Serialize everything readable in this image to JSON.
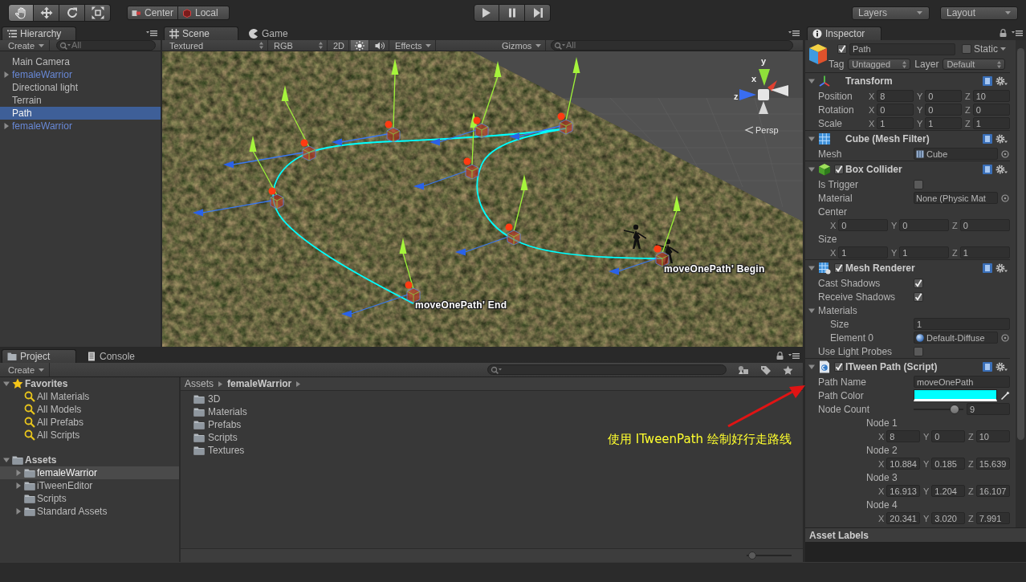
{
  "toolbar": {
    "tools": [
      {
        "kind": "hand",
        "selected": true
      },
      {
        "kind": "move",
        "selected": false
      },
      {
        "kind": "rotate",
        "selected": false
      },
      {
        "kind": "scale",
        "selected": false
      }
    ],
    "pivot": [
      {
        "kind": "pivot",
        "label": "Center"
      },
      {
        "kind": "space",
        "label": "Local"
      }
    ],
    "playback": [
      {
        "kind": "play"
      },
      {
        "kind": "pause"
      },
      {
        "kind": "step"
      }
    ],
    "layers": "Layers",
    "layout": "Layout"
  },
  "hierarchy": {
    "tab": "Hierarchy",
    "create": "Create",
    "search_placeholder": "All",
    "items": [
      {
        "label": "Main Camera",
        "prefab": false,
        "has_children": false,
        "selected": false
      },
      {
        "label": "femaleWarrior",
        "prefab": true,
        "has_children": true,
        "selected": false
      },
      {
        "label": "Directional light",
        "prefab": false,
        "has_children": false,
        "selected": false
      },
      {
        "label": "Terrain",
        "prefab": false,
        "has_children": false,
        "selected": false
      },
      {
        "label": "Path",
        "prefab": false,
        "has_children": false,
        "selected": true
      },
      {
        "label": "femaleWarrior",
        "prefab": true,
        "has_children": true,
        "selected": false
      }
    ]
  },
  "scene": {
    "tabs": [
      {
        "kind": "scene",
        "label": "Scene",
        "selected": true
      },
      {
        "kind": "game",
        "label": "Game",
        "selected": false
      }
    ],
    "toolbar": {
      "draw_mode": "Textured",
      "channel": "RGB",
      "buttons": [
        {
          "kind": "text",
          "label": "2D",
          "on": false
        },
        {
          "kind": "lighting",
          "on": true
        },
        {
          "kind": "audio",
          "on": false
        },
        {
          "kind": "menu",
          "label": "Effects",
          "on": false
        }
      ],
      "gizmos": "Gizmos",
      "search_placeholder": "All"
    },
    "view": {
      "axes": [
        {
          "label": "y"
        },
        {
          "label": "x"
        },
        {
          "label": "z"
        }
      ],
      "projection": "Persp",
      "path_labels": [
        {
          "kind": "begin",
          "text": "moveOnePath' Begin"
        },
        {
          "kind": "end",
          "text": "moveOnePath' End"
        }
      ]
    }
  },
  "inspector": {
    "tab": "Inspector",
    "object": {
      "active": true,
      "name": "Path",
      "static": false,
      "static_label": "Static",
      "tag_label": "Tag",
      "tag": "Untagged",
      "layer_label": "Layer",
      "layer": "Default"
    },
    "components": [
      {
        "kind": "transform",
        "title": "Transform",
        "rows": [
          {
            "kind": "vector3",
            "label": "Position",
            "fields": [
              {
                "axis": "X",
                "value": "8"
              },
              {
                "axis": "Y",
                "value": "0"
              },
              {
                "axis": "Z",
                "value": "10"
              }
            ]
          },
          {
            "kind": "vector3",
            "label": "Rotation",
            "fields": [
              {
                "axis": "X",
                "value": "0"
              },
              {
                "axis": "Y",
                "value": "0"
              },
              {
                "axis": "Z",
                "value": "0"
              }
            ]
          },
          {
            "kind": "vector3",
            "label": "Scale",
            "fields": [
              {
                "axis": "X",
                "value": "1"
              },
              {
                "axis": "Y",
                "value": "1"
              },
              {
                "axis": "Z",
                "value": "1"
              }
            ]
          }
        ]
      },
      {
        "kind": "mesh_filter",
        "title": "Cube (Mesh Filter)",
        "rows": [
          {
            "kind": "object",
            "label": "Mesh",
            "object": {
              "kind": "mesh",
              "label": "Cube"
            }
          }
        ]
      },
      {
        "kind": "box_collider",
        "title": "Box Collider",
        "toggle": {
          "checked": true
        },
        "rows": [
          {
            "kind": "checkbox",
            "label": "Is Trigger",
            "checked": false
          },
          {
            "kind": "object",
            "label": "Material",
            "object": {
              "kind": "none",
              "label": "None (Physic Mat"
            }
          },
          {
            "kind": "vector3_block",
            "label": "Center",
            "fields": [
              {
                "axis": "X",
                "value": "0"
              },
              {
                "axis": "Y",
                "value": "0"
              },
              {
                "axis": "Z",
                "value": "0"
              }
            ]
          },
          {
            "kind": "vector3_block",
            "label": "Size",
            "fields": [
              {
                "axis": "X",
                "value": "1"
              },
              {
                "axis": "Y",
                "value": "1"
              },
              {
                "axis": "Z",
                "value": "1"
              }
            ]
          }
        ]
      },
      {
        "kind": "mesh_renderer",
        "title": "Mesh Renderer",
        "toggle": {
          "checked": true
        },
        "rows": [
          {
            "kind": "checkbox",
            "label": "Cast Shadows",
            "checked": true
          },
          {
            "kind": "checkbox",
            "label": "Receive Shadows",
            "checked": true
          },
          {
            "kind": "foldout",
            "label": "Materials",
            "expanded": true,
            "children": [
              {
                "kind": "text",
                "label": "Size",
                "value": "1"
              },
              {
                "kind": "object",
                "label": "Element 0",
                "object": {
                  "kind": "material",
                  "label": "Default-Diffuse"
                }
              }
            ]
          },
          {
            "kind": "checkbox",
            "label": "Use Light Probes",
            "checked": false
          }
        ]
      },
      {
        "kind": "script",
        "title": "ITween Path (Script)",
        "toggle": {
          "checked": true
        },
        "rows": [
          {
            "kind": "text",
            "label": "Path Name",
            "value": "moveOnePath"
          },
          {
            "kind": "color",
            "label": "Path Color",
            "color": "#00ffff"
          },
          {
            "kind": "slider",
            "label": "Node Count",
            "level": 0.9,
            "value": "9"
          },
          {
            "kind": "nodes",
            "children": [
              {
                "kind": "vector3_block",
                "label": "Node 1",
                "fields": [
                  {
                    "axis": "X",
                    "value": "8"
                  },
                  {
                    "axis": "Y",
                    "value": "0"
                  },
                  {
                    "axis": "Z",
                    "value": "10"
                  }
                ]
              },
              {
                "kind": "vector3_block",
                "label": "Node 2",
                "fields": [
                  {
                    "axis": "X",
                    "value": "10.884"
                  },
                  {
                    "axis": "Y",
                    "value": "0.185"
                  },
                  {
                    "axis": "Z",
                    "value": "15.639"
                  }
                ]
              },
              {
                "kind": "vector3_block",
                "label": "Node 3",
                "fields": [
                  {
                    "axis": "X",
                    "value": "16.913"
                  },
                  {
                    "axis": "Y",
                    "value": "1.204"
                  },
                  {
                    "axis": "Z",
                    "value": "16.107"
                  }
                ]
              },
              {
                "kind": "vector3_block",
                "label": "Node 4",
                "fields": [
                  {
                    "axis": "X",
                    "value": "20.341"
                  },
                  {
                    "axis": "Y",
                    "value": "3.020"
                  },
                  {
                    "axis": "Z",
                    "value": "7.991"
                  }
                ]
              }
            ]
          }
        ]
      }
    ],
    "asset_labels": "Asset Labels"
  },
  "project": {
    "tabs": [
      {
        "kind": "project",
        "label": "Project",
        "selected": true
      },
      {
        "kind": "console",
        "label": "Console",
        "selected": false
      }
    ],
    "create": "Create",
    "tree": [
      {
        "kind": "favorites",
        "label": "Favorites",
        "expanded": true,
        "selected": false,
        "children": [
          {
            "kind": "search",
            "label": "All Materials",
            "selected": false
          },
          {
            "kind": "search",
            "label": "All Models",
            "selected": false
          },
          {
            "kind": "search",
            "label": "All Prefabs",
            "selected": false
          },
          {
            "kind": "search",
            "label": "All Scripts",
            "selected": false
          }
        ]
      },
      {
        "kind": "folder",
        "label": "Assets",
        "expanded": true,
        "selected": false,
        "children": [
          {
            "kind": "folder",
            "label": "femaleWarrior",
            "has_children": true,
            "selected": true
          },
          {
            "kind": "folder",
            "label": "iTweenEditor",
            "has_children": true,
            "selected": false
          },
          {
            "kind": "folder",
            "label": "Scripts",
            "has_children": false,
            "selected": false
          },
          {
            "kind": "folder",
            "label": "Standard Assets",
            "has_children": true,
            "selected": false
          }
        ]
      }
    ],
    "breadcrumb": [
      "Assets",
      "femaleWarrior"
    ],
    "folders": [
      "3D",
      "Materials",
      "Prefabs",
      "Scripts",
      "Textures"
    ],
    "zoom": {
      "level": 0.05
    }
  },
  "annotation": {
    "text": "使用 ITweenPath 绘制好行走路线"
  }
}
